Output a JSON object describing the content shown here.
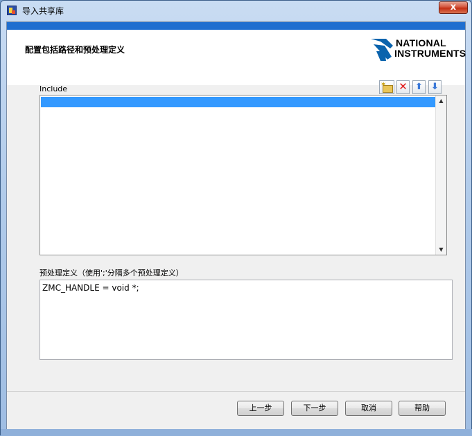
{
  "window": {
    "title": "导入共享库",
    "close_glyph": "x"
  },
  "header": {
    "title": "配置包括路径和预处理定义",
    "logo": {
      "line1": "NATIONAL",
      "line2": "INSTRUMENTS"
    }
  },
  "include": {
    "label": "Include",
    "toolbar": {
      "new_icon": "new-folder-icon",
      "delete_glyph": "✕",
      "up_glyph": "⬆",
      "down_glyph": "⬇"
    },
    "items": [
      ""
    ],
    "scroll_up_glyph": "▲",
    "scroll_down_glyph": "▼"
  },
  "preprocessor": {
    "label": "预处理定义（使用';'分隔多个预处理定义）",
    "value": "ZMC_HANDLE = void *;"
  },
  "buttons": {
    "prev": "上一步",
    "next": "下一步",
    "cancel": "取消",
    "help": "帮助"
  },
  "colors": {
    "header_strip": "#1f6ecf",
    "selection": "#3399ff",
    "close_button": "#c32f15"
  }
}
